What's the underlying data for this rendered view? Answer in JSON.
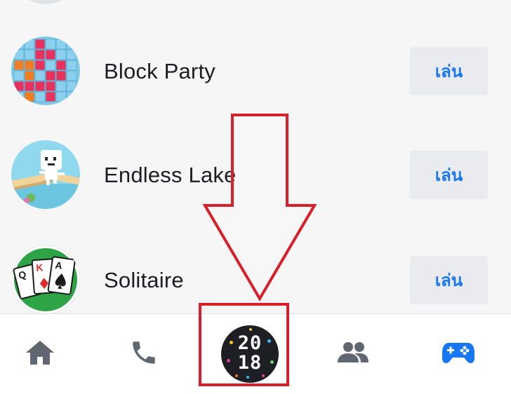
{
  "games": [
    {
      "name": "Block Party",
      "play_label": "เล่น"
    },
    {
      "name": "Endless Lake",
      "play_label": "เล่น"
    },
    {
      "name": "Solitaire",
      "play_label": "เล่น"
    }
  ],
  "tab_bar": {
    "tabs": [
      {
        "id": "home",
        "icon": "home-icon",
        "active": false
      },
      {
        "id": "calls",
        "icon": "phone-icon",
        "active": false
      },
      {
        "id": "year",
        "icon": "2018-badge-icon",
        "active": false,
        "badge_line1": "20",
        "badge_line2": "18"
      },
      {
        "id": "people",
        "icon": "people-icon",
        "active": false
      },
      {
        "id": "games",
        "icon": "gamepad-icon",
        "active": true
      }
    ]
  },
  "colors": {
    "accent": "#1877f2",
    "inactive_icon": "#606770",
    "annotation_red": "#d8202a",
    "button_bg": "#e9ebee"
  },
  "annotation": {
    "type": "down-arrow-with-box",
    "target": "year-tab"
  }
}
